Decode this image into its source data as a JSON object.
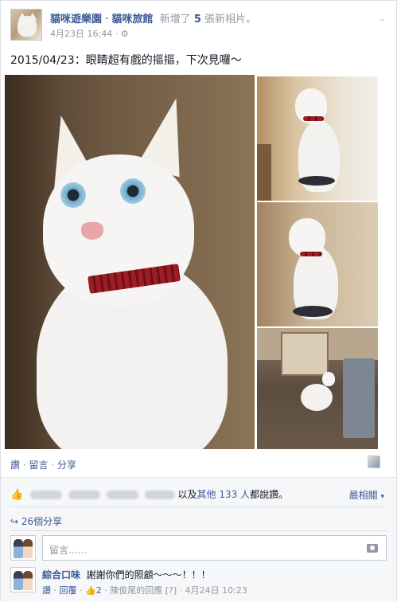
{
  "post": {
    "page_name": "貓咪遊樂園",
    "sep": " · ",
    "album_name": "貓咪旅館",
    "action_prefix": "新增了",
    "photo_count": "5",
    "action_suffix": "張新相片。",
    "date": "4月23日 16:44",
    "privacy_sep": "·",
    "privacy_icon": "⚙",
    "text": "2015/04/23：眼睛超有戲的摳摳，下次見囉～"
  },
  "actions": {
    "like": "讚",
    "dot1": " · ",
    "comment": "留言",
    "dot2": " · ",
    "share": "分享"
  },
  "feedback": {
    "likes_and": "以及",
    "likes_others": "其他 133 人",
    "likes_suffix": "都說讚。",
    "most_relevant": "最相關",
    "shares": "26個分享",
    "comment_placeholder": "留言……"
  },
  "comment": {
    "author": "綜合口味",
    "text": "謝謝你們的照顧～～～！！！",
    "like": "讚",
    "dot1": " · ",
    "reply": "回覆",
    "dot2": " · ",
    "like_count": "2",
    "dot3": " · ",
    "reply_by": "陳俊尾的回應",
    "help": "[?]",
    "dot4": " · ",
    "time": "4月24日 10:23"
  },
  "colors": {
    "link": "#3b5998",
    "meta": "#9197a3",
    "feedback_bg": "#f6f7f9"
  }
}
